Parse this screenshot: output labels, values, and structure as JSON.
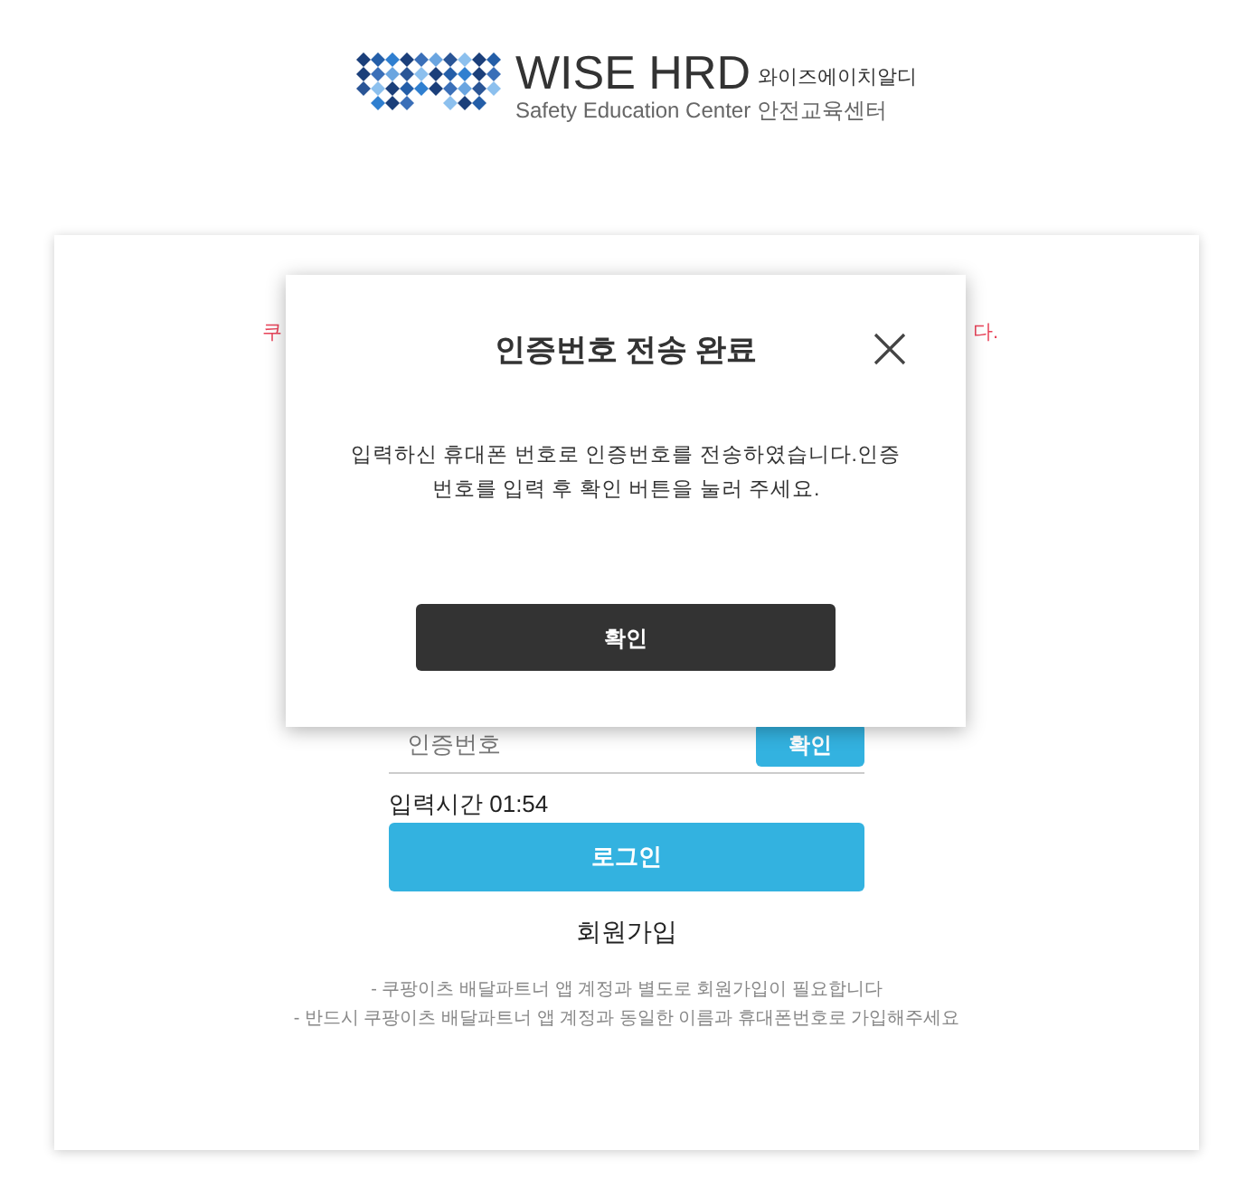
{
  "logo": {
    "title": "WISE HRD",
    "korean": "와이즈에이치알디",
    "subtitle": "Safety Education Center 안전교육센터"
  },
  "card": {
    "notice_left": "쿠",
    "notice_right": "다.",
    "code_field": {
      "placeholder": "인증번호"
    },
    "confirm_button": "확인",
    "timer_label": "입력시간 01:54",
    "login_button": "로그인",
    "signup_link": "회원가입",
    "notes": [
      "- 쿠팡이츠 배달파트너 앱 계정과 별도로 회원가입이 필요합니다",
      "- 반드시 쿠팡이츠 배달파트너 앱 계정과 동일한 이름과 휴대폰번호로 가입해주세요"
    ]
  },
  "modal": {
    "title": "인증번호 전송 완료",
    "message": "입력하신 휴대폰 번호로 인증번호를 전송하였습니다.인증번호를 입력 후 확인 버튼을 눌러 주세요.",
    "button": "확인"
  }
}
